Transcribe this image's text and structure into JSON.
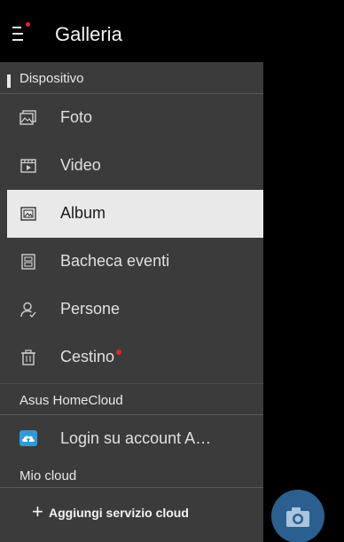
{
  "app_bar": {
    "title": "Galleria",
    "menu_icon": "hamburger-menu-icon",
    "notification_color": "#e0262b"
  },
  "drawer": {
    "device_section": {
      "header": "Dispositivo",
      "items": [
        {
          "label": "Foto",
          "icon": "photo-icon",
          "selected": false
        },
        {
          "label": "Video",
          "icon": "video-icon",
          "selected": false
        },
        {
          "label": "Album",
          "icon": "album-icon",
          "selected": true
        },
        {
          "label": "Bacheca eventi",
          "icon": "event-board-icon",
          "selected": false
        },
        {
          "label": "Persone",
          "icon": "person-icon",
          "selected": false
        },
        {
          "label": "Cestino",
          "icon": "trash-icon",
          "selected": false,
          "badge": true
        }
      ]
    },
    "homecloud_section": {
      "header": "Asus HomeCloud",
      "items": [
        {
          "label": "Login su account A…",
          "icon": "cloud-icon"
        }
      ]
    },
    "mycloud_section": {
      "header": "Mio cloud",
      "add_service_label": "Aggiungi servizio cloud",
      "add_icon": "plus-icon"
    }
  },
  "fab": {
    "icon": "camera-icon",
    "color": "#2a5f8f"
  },
  "colors": {
    "drawer_bg": "#3b3b3b",
    "selected_bg": "#e9e9e9",
    "accent_red": "#e0262b",
    "cloud_blue": "#2f9bd8"
  }
}
